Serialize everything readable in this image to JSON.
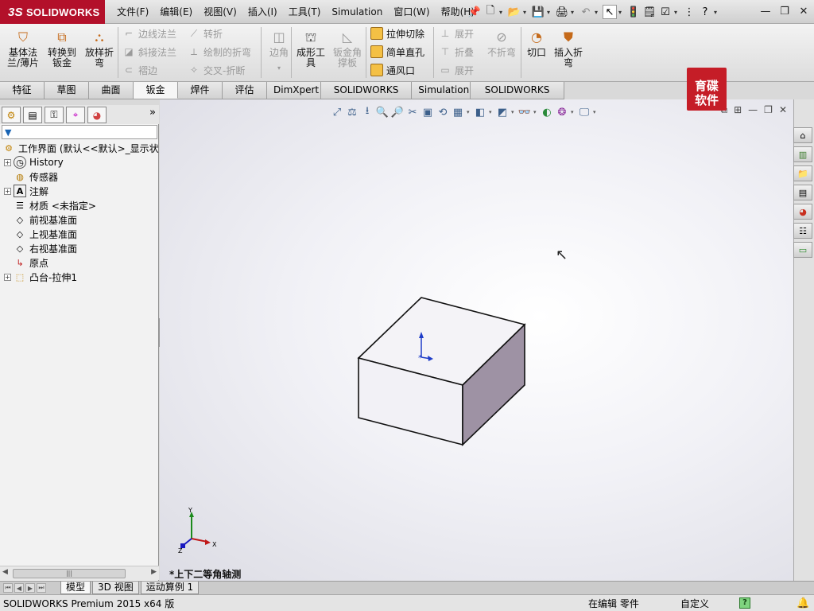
{
  "app": {
    "brand": "SOLIDWORKS",
    "brand_mark": "3S"
  },
  "menu": [
    "文件(F)",
    "编辑(E)",
    "视图(V)",
    "插入(I)",
    "工具(T)",
    "Simulation",
    "窗口(W)",
    "帮助(H)"
  ],
  "ribbon": {
    "big_buttons": [
      {
        "label": "基体法\n兰/薄片",
        "icon": "base-flange-icon",
        "enabled": true
      },
      {
        "label": "转换到\n钣金",
        "icon": "convert-to-sheetmetal-icon",
        "enabled": true
      },
      {
        "label": "放样折\n弯",
        "icon": "lofted-bend-icon",
        "enabled": true
      }
    ],
    "col1": [
      {
        "label": "边线法兰",
        "enabled": false
      },
      {
        "label": "斜接法兰",
        "enabled": false
      },
      {
        "label": "褶边",
        "enabled": false
      }
    ],
    "col2": [
      {
        "label": "转折",
        "enabled": false
      },
      {
        "label": "绘制的折弯",
        "enabled": false
      },
      {
        "label": "交叉-折断",
        "enabled": false
      }
    ],
    "corner": {
      "label": "边角",
      "enabled": false
    },
    "forming_tool": {
      "label": "成形工\n具",
      "enabled": true
    },
    "gusset": {
      "label": "钣金角\n撑板",
      "enabled": false
    },
    "col3": [
      {
        "label": "拉伸切除",
        "enabled": true
      },
      {
        "label": "简单直孔",
        "enabled": true
      },
      {
        "label": "通风口",
        "enabled": true
      }
    ],
    "col4": [
      {
        "label": "展开",
        "enabled": false
      },
      {
        "label": "折叠",
        "enabled": false
      },
      {
        "label": "展开",
        "enabled": false
      }
    ],
    "no_bends": {
      "label": "不折弯",
      "enabled": false
    },
    "rip": {
      "label": "切口",
      "enabled": true
    },
    "insert_bends": {
      "label": "插入折\n弯",
      "enabled": true
    }
  },
  "tabs": [
    "特征",
    "草图",
    "曲面",
    "钣金",
    "焊件",
    "评估",
    "DimXpert",
    "SOLIDWORKS 插件",
    "Simulation",
    "SOLIDWORKS MBD"
  ],
  "active_tab": "钣金",
  "tree": {
    "root": "工作界面  (默认<<默认>_显示状",
    "items": [
      {
        "label": "History",
        "expandable": true,
        "icon": "history-icon"
      },
      {
        "label": "传感器",
        "expandable": false,
        "icon": "sensor-icon"
      },
      {
        "label": "注解",
        "expandable": true,
        "icon": "annotation-icon"
      },
      {
        "label": "材质 <未指定>",
        "expandable": false,
        "icon": "material-icon"
      },
      {
        "label": "前视基准面",
        "expandable": false,
        "icon": "plane-icon"
      },
      {
        "label": "上视基准面",
        "expandable": false,
        "icon": "plane-icon"
      },
      {
        "label": "右视基准面",
        "expandable": false,
        "icon": "plane-icon"
      },
      {
        "label": "原点",
        "expandable": false,
        "icon": "origin-icon"
      },
      {
        "label": "凸台-拉伸1",
        "expandable": true,
        "icon": "extrude-icon"
      }
    ]
  },
  "viewport": {
    "view_name": "*上下二等角轴测",
    "watermark": "育碟\n软件",
    "triad_labels": {
      "x": "X",
      "y": "Y",
      "z": "Z"
    }
  },
  "sheet_tabs": [
    "模型",
    "3D 视图",
    "运动算例 1"
  ],
  "active_sheet": "模型",
  "status": {
    "product": "SOLIDWORKS Premium 2015 x64 版",
    "editing": "在编辑 零件",
    "units": "自定义",
    "help": "?"
  },
  "colors": {
    "brand_red": "#b3102a",
    "selected_axis": "#1e3cc8"
  }
}
